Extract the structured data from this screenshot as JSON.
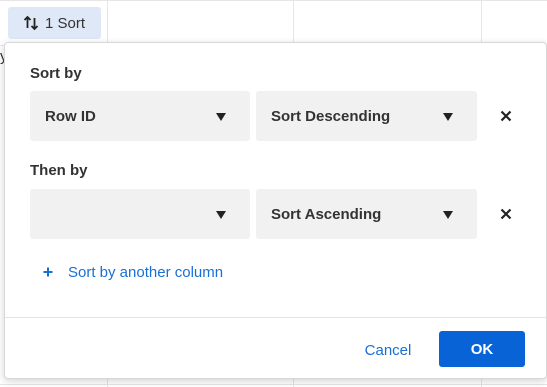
{
  "toolbar": {
    "sort_button_label": "1 Sort",
    "sort_icon": "sort-arrows-icon"
  },
  "background": {
    "edge_text": "y"
  },
  "popover": {
    "sort_by_label": "Sort by",
    "then_by_label": "Then by",
    "rows": [
      {
        "column": "Row ID",
        "direction": "Sort Descending"
      },
      {
        "column": "",
        "direction": "Sort Ascending"
      }
    ],
    "add_column_label": "Sort by another column",
    "cancel_label": "Cancel",
    "ok_label": "OK"
  },
  "colors": {
    "accent": "#0864d6",
    "link": "#1a6fd6",
    "sort_button_bg": "#dfe8f6",
    "dropdown_bg": "#f1f1f1"
  }
}
